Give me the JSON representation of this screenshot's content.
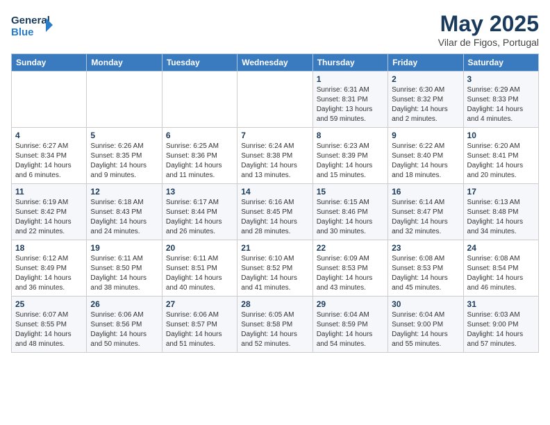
{
  "header": {
    "logo_general": "General",
    "logo_blue": "Blue",
    "month_title": "May 2025",
    "subtitle": "Vilar de Figos, Portugal"
  },
  "days_of_week": [
    "Sunday",
    "Monday",
    "Tuesday",
    "Wednesday",
    "Thursday",
    "Friday",
    "Saturday"
  ],
  "weeks": [
    [
      {
        "num": "",
        "info": ""
      },
      {
        "num": "",
        "info": ""
      },
      {
        "num": "",
        "info": ""
      },
      {
        "num": "",
        "info": ""
      },
      {
        "num": "1",
        "info": "Sunrise: 6:31 AM\nSunset: 8:31 PM\nDaylight: 13 hours and 59 minutes."
      },
      {
        "num": "2",
        "info": "Sunrise: 6:30 AM\nSunset: 8:32 PM\nDaylight: 14 hours and 2 minutes."
      },
      {
        "num": "3",
        "info": "Sunrise: 6:29 AM\nSunset: 8:33 PM\nDaylight: 14 hours and 4 minutes."
      }
    ],
    [
      {
        "num": "4",
        "info": "Sunrise: 6:27 AM\nSunset: 8:34 PM\nDaylight: 14 hours and 6 minutes."
      },
      {
        "num": "5",
        "info": "Sunrise: 6:26 AM\nSunset: 8:35 PM\nDaylight: 14 hours and 9 minutes."
      },
      {
        "num": "6",
        "info": "Sunrise: 6:25 AM\nSunset: 8:36 PM\nDaylight: 14 hours and 11 minutes."
      },
      {
        "num": "7",
        "info": "Sunrise: 6:24 AM\nSunset: 8:38 PM\nDaylight: 14 hours and 13 minutes."
      },
      {
        "num": "8",
        "info": "Sunrise: 6:23 AM\nSunset: 8:39 PM\nDaylight: 14 hours and 15 minutes."
      },
      {
        "num": "9",
        "info": "Sunrise: 6:22 AM\nSunset: 8:40 PM\nDaylight: 14 hours and 18 minutes."
      },
      {
        "num": "10",
        "info": "Sunrise: 6:20 AM\nSunset: 8:41 PM\nDaylight: 14 hours and 20 minutes."
      }
    ],
    [
      {
        "num": "11",
        "info": "Sunrise: 6:19 AM\nSunset: 8:42 PM\nDaylight: 14 hours and 22 minutes."
      },
      {
        "num": "12",
        "info": "Sunrise: 6:18 AM\nSunset: 8:43 PM\nDaylight: 14 hours and 24 minutes."
      },
      {
        "num": "13",
        "info": "Sunrise: 6:17 AM\nSunset: 8:44 PM\nDaylight: 14 hours and 26 minutes."
      },
      {
        "num": "14",
        "info": "Sunrise: 6:16 AM\nSunset: 8:45 PM\nDaylight: 14 hours and 28 minutes."
      },
      {
        "num": "15",
        "info": "Sunrise: 6:15 AM\nSunset: 8:46 PM\nDaylight: 14 hours and 30 minutes."
      },
      {
        "num": "16",
        "info": "Sunrise: 6:14 AM\nSunset: 8:47 PM\nDaylight: 14 hours and 32 minutes."
      },
      {
        "num": "17",
        "info": "Sunrise: 6:13 AM\nSunset: 8:48 PM\nDaylight: 14 hours and 34 minutes."
      }
    ],
    [
      {
        "num": "18",
        "info": "Sunrise: 6:12 AM\nSunset: 8:49 PM\nDaylight: 14 hours and 36 minutes."
      },
      {
        "num": "19",
        "info": "Sunrise: 6:11 AM\nSunset: 8:50 PM\nDaylight: 14 hours and 38 minutes."
      },
      {
        "num": "20",
        "info": "Sunrise: 6:11 AM\nSunset: 8:51 PM\nDaylight: 14 hours and 40 minutes."
      },
      {
        "num": "21",
        "info": "Sunrise: 6:10 AM\nSunset: 8:52 PM\nDaylight: 14 hours and 41 minutes."
      },
      {
        "num": "22",
        "info": "Sunrise: 6:09 AM\nSunset: 8:53 PM\nDaylight: 14 hours and 43 minutes."
      },
      {
        "num": "23",
        "info": "Sunrise: 6:08 AM\nSunset: 8:53 PM\nDaylight: 14 hours and 45 minutes."
      },
      {
        "num": "24",
        "info": "Sunrise: 6:08 AM\nSunset: 8:54 PM\nDaylight: 14 hours and 46 minutes."
      }
    ],
    [
      {
        "num": "25",
        "info": "Sunrise: 6:07 AM\nSunset: 8:55 PM\nDaylight: 14 hours and 48 minutes."
      },
      {
        "num": "26",
        "info": "Sunrise: 6:06 AM\nSunset: 8:56 PM\nDaylight: 14 hours and 50 minutes."
      },
      {
        "num": "27",
        "info": "Sunrise: 6:06 AM\nSunset: 8:57 PM\nDaylight: 14 hours and 51 minutes."
      },
      {
        "num": "28",
        "info": "Sunrise: 6:05 AM\nSunset: 8:58 PM\nDaylight: 14 hours and 52 minutes."
      },
      {
        "num": "29",
        "info": "Sunrise: 6:04 AM\nSunset: 8:59 PM\nDaylight: 14 hours and 54 minutes."
      },
      {
        "num": "30",
        "info": "Sunrise: 6:04 AM\nSunset: 9:00 PM\nDaylight: 14 hours and 55 minutes."
      },
      {
        "num": "31",
        "info": "Sunrise: 6:03 AM\nSunset: 9:00 PM\nDaylight: 14 hours and 57 minutes."
      }
    ]
  ]
}
